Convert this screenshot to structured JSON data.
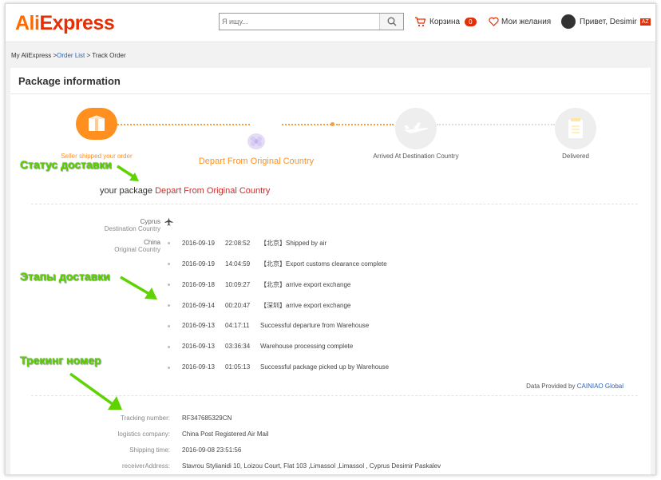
{
  "header": {
    "logo_part1": "Ali",
    "logo_part2": "Express",
    "search_placeholder": "Я ищу...",
    "cart_label": "Корзина",
    "cart_count": "0",
    "wishlist_label": "Мои желания",
    "greeting": "Привет, Desimir",
    "user_badge": "AZ"
  },
  "breadcrumb": {
    "root": "My AliExpress >",
    "orders": "Order List",
    "sep": ">",
    "current": "Track Order"
  },
  "panel": {
    "title": "Package information",
    "steps": [
      {
        "label": "Seller shipped your order"
      },
      {
        "label": "Depart From Original Country"
      },
      {
        "label": "Arrived At Destination Country"
      },
      {
        "label": "Delivered"
      }
    ],
    "status_prefix": "your package",
    "status_value": "Depart From Original Country",
    "locations": [
      {
        "name": "Cyprus",
        "role": "Destination Country"
      },
      {
        "name": "China",
        "role": "Original Country"
      }
    ],
    "events": [
      {
        "date": "2016-09-19",
        "time": "22:08:52",
        "desc": "【北京】Shipped by air"
      },
      {
        "date": "2016-09-19",
        "time": "14:04:59",
        "desc": "【北京】Export customs clearance complete"
      },
      {
        "date": "2016-09-18",
        "time": "10:09:27",
        "desc": "【北京】arrive export exchange"
      },
      {
        "date": "2016-09-14",
        "time": "00:20:47",
        "desc": "【深圳】arrive export exchange"
      },
      {
        "date": "2016-09-13",
        "time": "04:17:11",
        "desc": "Successful departure from Warehouse"
      },
      {
        "date": "2016-09-13",
        "time": "03:36:34",
        "desc": "Warehouse processing complete"
      },
      {
        "date": "2016-09-13",
        "time": "01:05:13",
        "desc": "Successful package picked up by Warehouse"
      }
    ],
    "provider_prefix": "Data Provided by",
    "provider_name": "CAINIAO Global",
    "info": [
      {
        "label": "Tracking number:",
        "value": "RF347685329CN"
      },
      {
        "label": "logistics company:",
        "value": "China Post Registered Air Mail"
      },
      {
        "label": "Shipping time:",
        "value": "2016-09-08 23:51:56"
      },
      {
        "label": "receiverAddress:",
        "value": "Stavrou Stylianidi 10, Loizou Court, Flat 103 ,Limassol ,Limassol , Cyprus  Desimir Paskalev"
      }
    ]
  },
  "annotations": {
    "status": "Статус доставки",
    "stages": "Этапы доставки",
    "tracking": "Трекинг номер"
  },
  "colors": {
    "accent": "#ff6a00",
    "brand_red": "#e62e04",
    "annotation_green": "#5dd300",
    "link": "#2a63c0"
  }
}
